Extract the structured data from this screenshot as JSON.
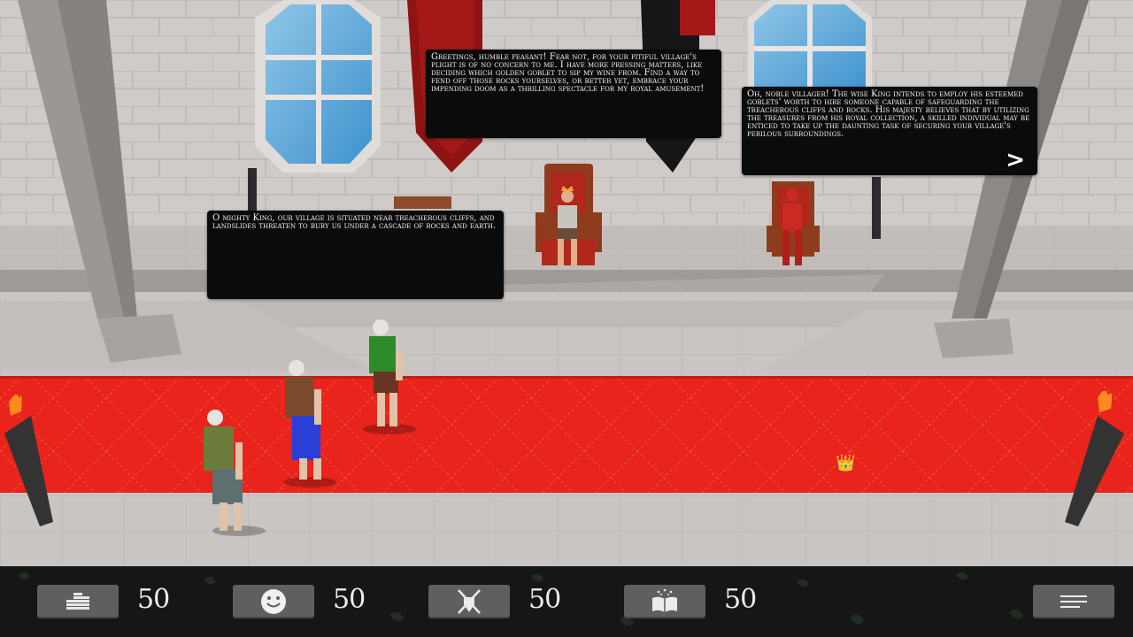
{
  "dialogs": {
    "king": "Greetings, humble peasant! Fear not, for your pitiful village's plight is of no concern to me. I have more pressing matters, like deciding which golden goblet to sip my wine from. Find a way to fend off those rocks yourselves, or better yet, embrace your impending doom as a thrilling spectacle for my royal amusement!",
    "advisor": "Oh, noble villager! The wise King intends to employ his esteemed goblets' worth to hire someone capable of safeguarding the treacherous cliffs and rocks. His majesty believes that by utilizing the treasures from his royal collection, a skilled individual may be enticed to take up the daunting task of securing your village's perilous surroundings.",
    "villager": "O mighty King, our village is situated near treacherous cliffs, and landslides threaten to bury us under a cascade of rocks and earth.",
    "next_label": ">"
  },
  "world": {
    "crown_marker": "👑"
  },
  "hud": {
    "gold": {
      "icon": "coins-icon",
      "value": "50"
    },
    "happiness": {
      "icon": "smiley-icon",
      "value": "50"
    },
    "military": {
      "icon": "crossed-swords-shield-icon",
      "value": "50"
    },
    "knowledge": {
      "icon": "open-book-icon",
      "value": "50"
    }
  },
  "colors": {
    "carpet": "#e8241c",
    "dialog_bg": "#0b0b0b",
    "hud_bg": "#151615",
    "hud_button": "#5f5f5f"
  }
}
